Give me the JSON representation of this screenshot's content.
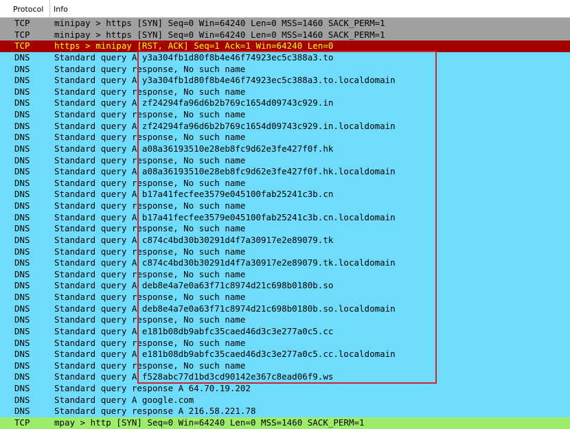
{
  "columns": {
    "protocol": "Protocol",
    "info": "Info"
  },
  "colors": {
    "tcp_syn": "#a0a0a0",
    "tcp_rst": "#a40000",
    "dns": "#6fdcfb",
    "tcp_green": "#9ded6b",
    "highlight_box": "#cc2233"
  },
  "rows": [
    {
      "protocol": "TCP",
      "info": "minipay > https [SYN] Seq=0 Win=64240 Len=0 MSS=1460 SACK_PERM=1",
      "style": "tcp_syn"
    },
    {
      "protocol": "TCP",
      "info": "minipay > https [SYN] Seq=0 Win=64240 Len=0 MSS=1460 SACK_PERM=1",
      "style": "tcp_syn"
    },
    {
      "protocol": "TCP",
      "info": "https > minipay [RST, ACK] Seq=1 Ack=1 Win=64240 Len=0",
      "style": "tcp_rst"
    },
    {
      "protocol": "DNS",
      "info": "Standard query A y3a304fb1d80f8b4e46f74923ec5c388a3.to",
      "style": "dns"
    },
    {
      "protocol": "DNS",
      "info": "Standard query response, No such name",
      "style": "dns"
    },
    {
      "protocol": "DNS",
      "info": "Standard query A y3a304fb1d80f8b4e46f74923ec5c388a3.to.localdomain",
      "style": "dns"
    },
    {
      "protocol": "DNS",
      "info": "Standard query response, No such name",
      "style": "dns"
    },
    {
      "protocol": "DNS",
      "info": "Standard query A zf24294fa96d6b2b769c1654d09743c929.in",
      "style": "dns"
    },
    {
      "protocol": "DNS",
      "info": "Standard query response, No such name",
      "style": "dns"
    },
    {
      "protocol": "DNS",
      "info": "Standard query A zf24294fa96d6b2b769c1654d09743c929.in.localdomain",
      "style": "dns"
    },
    {
      "protocol": "DNS",
      "info": "Standard query response, No such name",
      "style": "dns"
    },
    {
      "protocol": "DNS",
      "info": "Standard query A a08a36193510e28eb8fc9d62e3fe427f0f.hk",
      "style": "dns"
    },
    {
      "protocol": "DNS",
      "info": "Standard query response, No such name",
      "style": "dns"
    },
    {
      "protocol": "DNS",
      "info": "Standard query A a08a36193510e28eb8fc9d62e3fe427f0f.hk.localdomain",
      "style": "dns"
    },
    {
      "protocol": "DNS",
      "info": "Standard query response, No such name",
      "style": "dns"
    },
    {
      "protocol": "DNS",
      "info": "Standard query A b17a41fecfee3579e045100fab25241c3b.cn",
      "style": "dns"
    },
    {
      "protocol": "DNS",
      "info": "Standard query response, No such name",
      "style": "dns"
    },
    {
      "protocol": "DNS",
      "info": "Standard query A b17a41fecfee3579e045100fab25241c3b.cn.localdomain",
      "style": "dns"
    },
    {
      "protocol": "DNS",
      "info": "Standard query response, No such name",
      "style": "dns"
    },
    {
      "protocol": "DNS",
      "info": "Standard query A c874c4bd30b30291d4f7a30917e2e89079.tk",
      "style": "dns"
    },
    {
      "protocol": "DNS",
      "info": "Standard query response, No such name",
      "style": "dns"
    },
    {
      "protocol": "DNS",
      "info": "Standard query A c874c4bd30b30291d4f7a30917e2e89079.tk.localdomain",
      "style": "dns"
    },
    {
      "protocol": "DNS",
      "info": "Standard query response, No such name",
      "style": "dns"
    },
    {
      "protocol": "DNS",
      "info": "Standard query A deb8e4a7e0a63f71c8974d21c698b0180b.so",
      "style": "dns"
    },
    {
      "protocol": "DNS",
      "info": "Standard query response, No such name",
      "style": "dns"
    },
    {
      "protocol": "DNS",
      "info": "Standard query A deb8e4a7e0a63f71c8974d21c698b0180b.so.localdomain",
      "style": "dns"
    },
    {
      "protocol": "DNS",
      "info": "Standard query response, No such name",
      "style": "dns"
    },
    {
      "protocol": "DNS",
      "info": "Standard query A e181b08db9abfc35caed46d3c3e277a0c5.cc",
      "style": "dns"
    },
    {
      "protocol": "DNS",
      "info": "Standard query response, No such name",
      "style": "dns"
    },
    {
      "protocol": "DNS",
      "info": "Standard query A e181b08db9abfc35caed46d3c3e277a0c5.cc.localdomain",
      "style": "dns"
    },
    {
      "protocol": "DNS",
      "info": "Standard query response, No such name",
      "style": "dns"
    },
    {
      "protocol": "DNS",
      "info": "Standard query A f528abc77d1bd3cd90142e367c8ead06f9.ws",
      "style": "dns"
    },
    {
      "protocol": "DNS",
      "info": "Standard query response A 64.70.19.202",
      "style": "dns"
    },
    {
      "protocol": "DNS",
      "info": "Standard query A google.com",
      "style": "dns"
    },
    {
      "protocol": "DNS",
      "info": "Standard query response A 216.58.221.78",
      "style": "dns"
    },
    {
      "protocol": "TCP",
      "info": "mpay > http [SYN] Seq=0 Win=64240 Len=0 MSS=1460 SACK_PERM=1",
      "style": "tcp_green"
    }
  ]
}
